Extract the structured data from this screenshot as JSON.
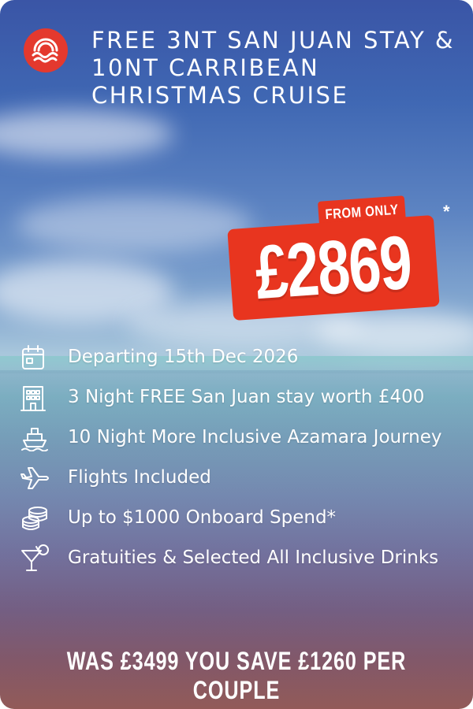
{
  "title": "FREE 3NT SAN JUAN STAY & 10NT CARRIBEAN CHRISTMAS CRUISE",
  "logo": {
    "icon": "wave-logo-icon",
    "color": "#e4392e"
  },
  "price": {
    "from_label": "FROM ONLY",
    "amount": "£2869",
    "asterisk": "*",
    "color": "#e8351f"
  },
  "features": [
    {
      "icon": "calendar-icon",
      "text": "Departing 15th Dec 2026"
    },
    {
      "icon": "hotel-icon",
      "text": "3 Night FREE San Juan stay worth £400"
    },
    {
      "icon": "ship-icon",
      "text": "10 Night More Inclusive Azamara Journey"
    },
    {
      "icon": "plane-icon",
      "text": "Flights Included"
    },
    {
      "icon": "coins-icon",
      "text": "Up to $1000 Onboard Spend*"
    },
    {
      "icon": "cocktail-icon",
      "text": "Gratuities & Selected All Inclusive Drinks"
    }
  ],
  "footer": "WAS £3499 YOU SAVE £1260 PER COUPLE"
}
